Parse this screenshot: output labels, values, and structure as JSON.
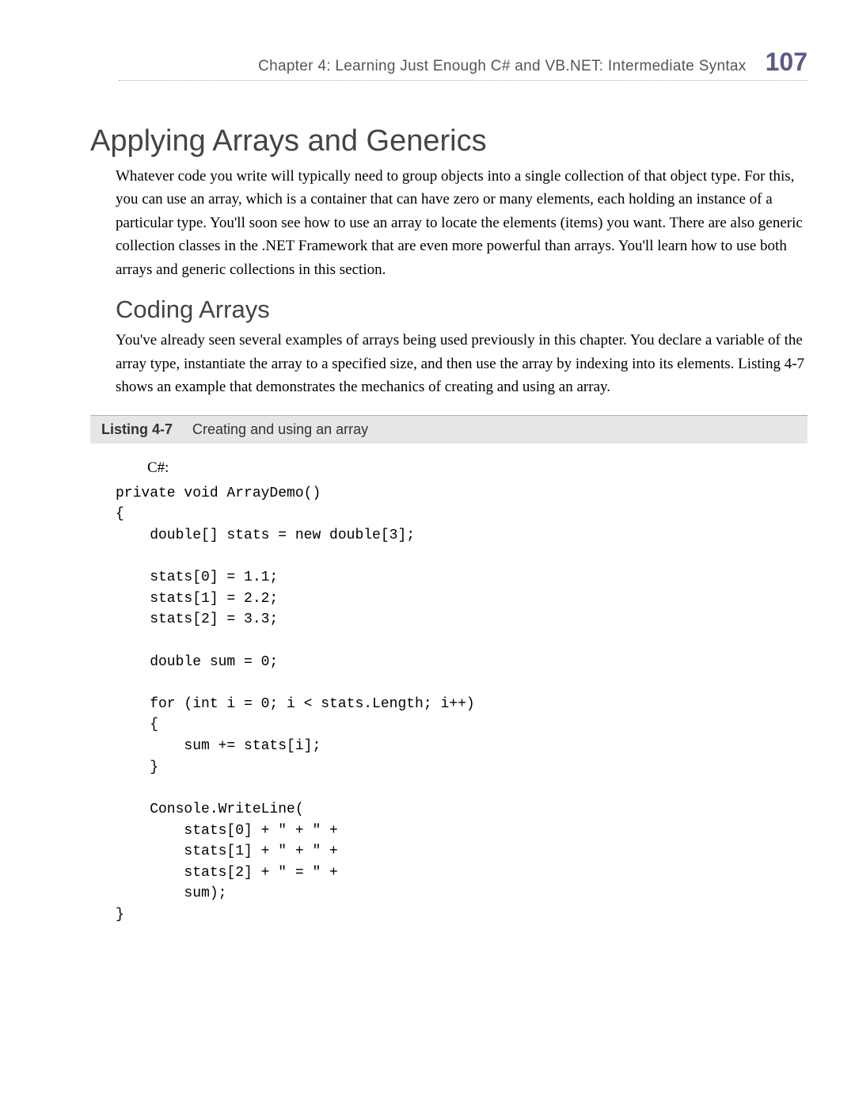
{
  "header": {
    "chapter": "Chapter 4:   Learning Just Enough C# and VB.NET: Intermediate Syntax",
    "page": "107"
  },
  "section": {
    "title": "Applying Arrays and Generics",
    "para1": "Whatever code you write will typically need to group objects into a single collection of that object type. For this, you can use an array, which is a container that can have zero or many elements, each holding an instance of a particular type. You'll soon see how to use an array to locate the elements (items) you want. There are also generic collection classes in the .NET Framework that are even more powerful than arrays. You'll learn how to use both arrays and generic collections in this section."
  },
  "subsection": {
    "title": "Coding Arrays",
    "para1": "You've already seen several examples of arrays being used previously in this chapter. You declare a variable of the array type, instantiate the array to a specified size, and then use the array by indexing into its elements. Listing 4-7 shows an example that demonstrates the mechanics of creating and using an array."
  },
  "listing": {
    "label": "Listing 4-7",
    "caption": "Creating and using an array",
    "lang": "C#:",
    "code": "private void ArrayDemo()\n{\n    double[] stats = new double[3];\n\n    stats[0] = 1.1;\n    stats[1] = 2.2;\n    stats[2] = 3.3;\n\n    double sum = 0;\n\n    for (int i = 0; i < stats.Length; i++)\n    {\n        sum += stats[i];\n    }\n\n    Console.WriteLine(\n        stats[0] + \" + \" +\n        stats[1] + \" + \" +\n        stats[2] + \" = \" +\n        sum);\n}"
  }
}
